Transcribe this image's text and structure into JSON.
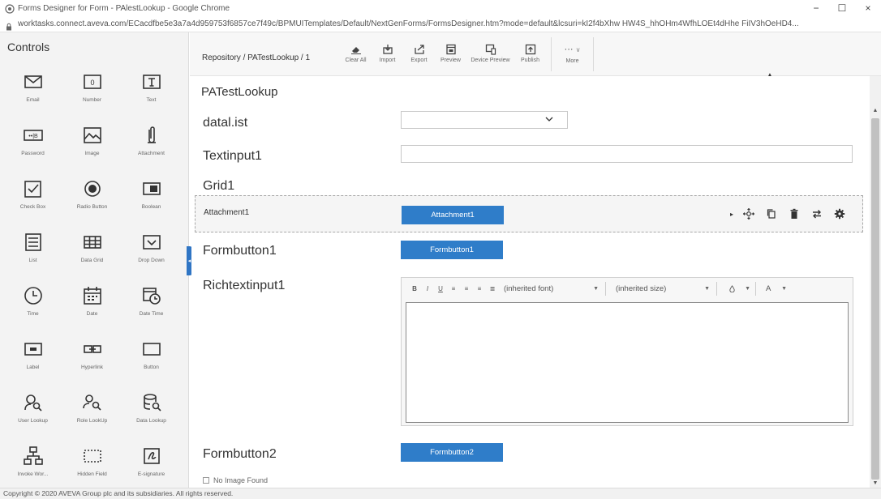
{
  "window": {
    "title": "Forms Designer for Form - PAlestLookup - Google Chrome",
    "minimize": "−",
    "maximize": "☐",
    "close": "×"
  },
  "address": {
    "url": "worktasks.connect.aveva.com/ECacdfbe5e3a7a4d959753f6857ce7f49c/BPMUITemplates/Default/NextGenForms/FormsDesigner.htm?mode=default&lcsuri=kI2f4bXhw HW4S_hhOHm4WfhLOEt4dHhe FiIV3hOeHD4..."
  },
  "controls": {
    "title": "Controls",
    "items": [
      {
        "label": "Email",
        "icon": "email-icon"
      },
      {
        "label": "Number",
        "icon": "number-icon"
      },
      {
        "label": "Text",
        "icon": "text-icon"
      },
      {
        "label": "Password",
        "icon": "password-icon"
      },
      {
        "label": "Image",
        "icon": "image-icon"
      },
      {
        "label": "Attachment",
        "icon": "attachment-icon"
      },
      {
        "label": "Check Box",
        "icon": "checkbox-icon"
      },
      {
        "label": "Radio Button",
        "icon": "radio-button-icon"
      },
      {
        "label": "Boolean",
        "icon": "boolean-icon"
      },
      {
        "label": "List",
        "icon": "list-icon"
      },
      {
        "label": "Data Grid",
        "icon": "data-grid-icon"
      },
      {
        "label": "Drop Down",
        "icon": "dropdown-icon"
      },
      {
        "label": "Time",
        "icon": "time-icon"
      },
      {
        "label": "Date",
        "icon": "date-icon"
      },
      {
        "label": "Date Time",
        "icon": "date-time-icon"
      },
      {
        "label": "Label",
        "icon": "label-icon"
      },
      {
        "label": "Hyperlink",
        "icon": "hyperlink-icon"
      },
      {
        "label": "Button",
        "icon": "button-icon"
      },
      {
        "label": "User Lookup",
        "icon": "user-lookup-icon"
      },
      {
        "label": "Role LookUp",
        "icon": "role-lookup-icon"
      },
      {
        "label": "Data Lookup",
        "icon": "data-lookup-icon"
      },
      {
        "label": "Invoke Wor...",
        "icon": "invoke-workflow-icon"
      },
      {
        "label": "Hidden Field",
        "icon": "hidden-field-icon"
      },
      {
        "label": "E-signature",
        "icon": "e-signature-icon"
      }
    ]
  },
  "header": {
    "breadcrumb": "Repository / PATestLookup / 1",
    "toolbar": {
      "clear_all": "Clear All",
      "import": "Import",
      "export": "Export",
      "preview": "Preview",
      "device_preview": "Device Preview",
      "publish": "Publish",
      "more": "More"
    }
  },
  "form": {
    "title": "PATestLookup",
    "fields": {
      "datalist_label": "datal.ist",
      "textinput_label": "Textinput1",
      "grid_label": "Grid1",
      "attachment_label": "Attachment1",
      "attachment_button": "Attachment1",
      "formbutton1_label": "Formbutton1",
      "formbutton1_button": "Formbutton1",
      "richtext_label": "Richtextinput1",
      "formbutton2_label": "Formbutton2",
      "formbutton2_button": "Formbutton2",
      "no_image": "No Image Found"
    },
    "richtext": {
      "bold": "B",
      "italic": "I",
      "underline": "U",
      "font": "(inherited font)",
      "size": "(inherited size)",
      "color_letter": "A"
    }
  },
  "footer": {
    "copyright": "Copyright © 2020 AVEVA Group plc and its subsidiaries. All rights reserved."
  },
  "colors": {
    "accent": "#2f7dc9",
    "panel": "#f3f3f3"
  }
}
